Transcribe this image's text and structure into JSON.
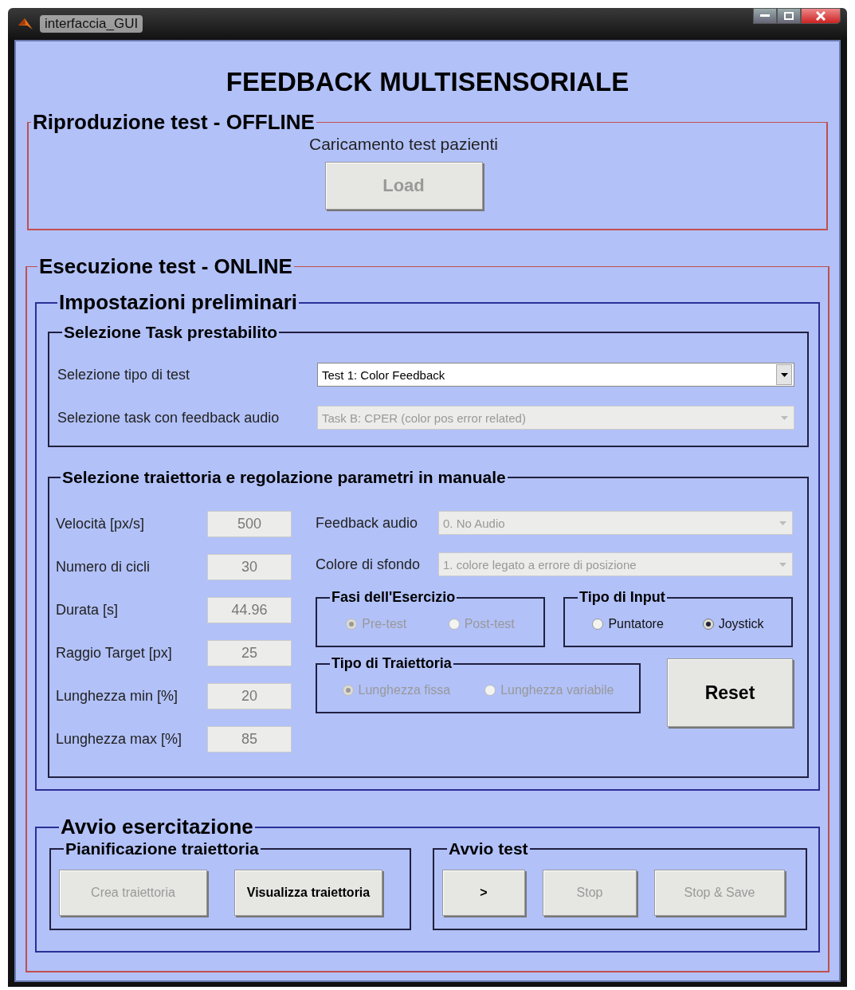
{
  "window": {
    "title": "interfaccia_GUI"
  },
  "heading": "FEEDBACK MULTISENSORIALE",
  "offline": {
    "title": "Riproduzione test  -  OFFLINE",
    "caption": "Caricamento test pazienti",
    "button": {
      "label": "Load",
      "disabled": true
    }
  },
  "online": {
    "title": "Esecuzione test  -  ONLINE",
    "preliminari": {
      "title": "Impostazioni preliminari",
      "task": {
        "title": "Selezione Task prestabilito",
        "rows": [
          {
            "label": "Selezione tipo di test",
            "value": "Test 1: Color Feedback",
            "disabled": false
          },
          {
            "label": "Selezione task con feedback audio",
            "value": "Task B: CPER (color pos error related)",
            "disabled": true
          }
        ]
      },
      "manual": {
        "title": "Selezione traiettoria e regolazione parametri in manuale",
        "params": [
          {
            "label": "Velocità [px/s]",
            "value": "500",
            "disabled": true
          },
          {
            "label": "Numero di cicli",
            "value": "30",
            "disabled": true
          },
          {
            "label": "Durata [s]",
            "value": "44.96",
            "disabled": true
          },
          {
            "label": "Raggio Target [px]",
            "value": "25",
            "disabled": true
          },
          {
            "label": "Lunghezza min [%]",
            "value": "20",
            "disabled": true
          },
          {
            "label": "Lunghezza max [%]",
            "value": "85",
            "disabled": true
          }
        ],
        "dropdowns": [
          {
            "label": "Feedback audio",
            "value": "0. No Audio",
            "disabled": true
          },
          {
            "label": "Colore di sfondo",
            "value": "1. colore legato a errore di posizione",
            "disabled": true
          }
        ],
        "groups": [
          {
            "title": "Fasi dell'Esercizio",
            "disabled": true,
            "options": [
              {
                "label": "Pre-test",
                "selected": true
              },
              {
                "label": "Post-test",
                "selected": false
              }
            ]
          },
          {
            "title": "Tipo di Input",
            "disabled": false,
            "options": [
              {
                "label": "Puntatore",
                "selected": false
              },
              {
                "label": "Joystick",
                "selected": true
              }
            ]
          },
          {
            "title": "Tipo di Traiettoria",
            "disabled": true,
            "options": [
              {
                "label": "Lunghezza fissa",
                "selected": true
              },
              {
                "label": "Lunghezza variabile",
                "selected": false
              }
            ]
          }
        ],
        "reset": {
          "label": "Reset",
          "disabled": false
        }
      }
    },
    "avvio": {
      "title": "Avvio esercitazione",
      "groups": [
        {
          "title": "Pianificazione traiettoria",
          "buttons": [
            {
              "label": "Crea traiettoria",
              "disabled": true
            },
            {
              "label": "Visualizza traiettoria",
              "disabled": false
            }
          ]
        },
        {
          "title": "Avvio test",
          "buttons": [
            {
              "label": ">",
              "disabled": false
            },
            {
              "label": "Stop",
              "disabled": true
            },
            {
              "label": "Stop & Save",
              "disabled": true
            }
          ]
        }
      ]
    }
  }
}
